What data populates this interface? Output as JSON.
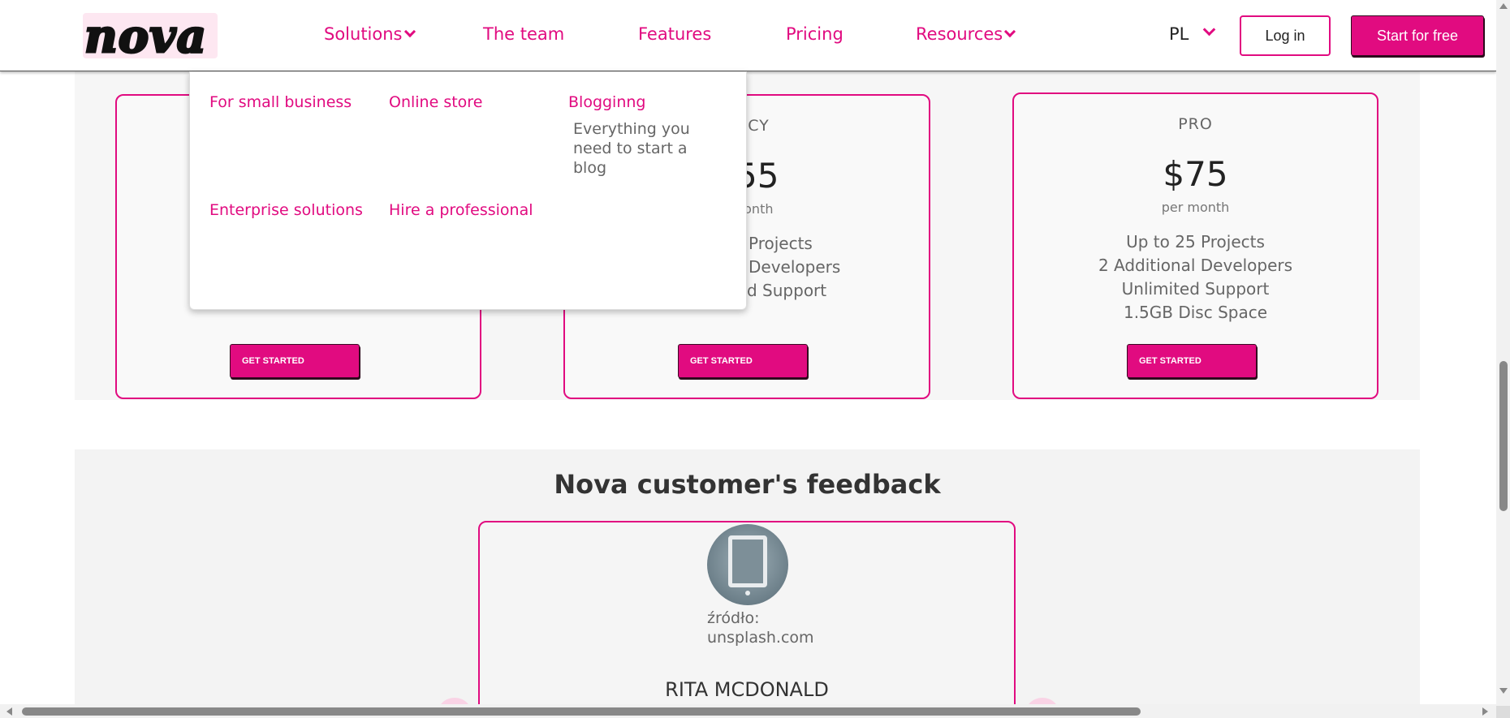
{
  "navbar": {
    "logo_text": "nova",
    "links": [
      {
        "label": "Solutions",
        "has_chevron": true
      },
      {
        "label": "The team",
        "has_chevron": false
      },
      {
        "label": "Features",
        "has_chevron": false
      },
      {
        "label": "Pricing",
        "has_chevron": false
      },
      {
        "label": "Resources",
        "has_chevron": true
      }
    ],
    "language": "PL",
    "login_label": "Log in",
    "start_label": "Start for free"
  },
  "dropdown": {
    "items": [
      {
        "label": "For small business"
      },
      {
        "label": "Online store"
      },
      {
        "label": "Blogginng",
        "description": "Everything you need to start a blog"
      },
      {
        "label": "Enterprise solutions"
      },
      {
        "label": "Hire a professional"
      }
    ]
  },
  "pricing": {
    "plans": [
      {
        "name": "",
        "price": "",
        "period": "",
        "features": [],
        "button": "GET STARTED"
      },
      {
        "name": "NCY",
        "price": "55",
        "period": "nonth",
        "features": [
          "Projects",
          "Developers",
          "d Support"
        ],
        "button": "GET STARTED"
      },
      {
        "name": "PRO",
        "price": "$75",
        "period": "per month",
        "features": [
          "Up to 25 Projects",
          "2 Additional Developers",
          "Unlimited Support",
          "1.5GB Disc Space"
        ],
        "button": "GET STARTED"
      }
    ]
  },
  "feedback": {
    "title": "Nova customer's feedback",
    "source": "źródło: unsplash.com",
    "name": "RITA MCDONALD"
  },
  "colors": {
    "accent": "#e10b80",
    "band_background": "#f6f6f6"
  }
}
